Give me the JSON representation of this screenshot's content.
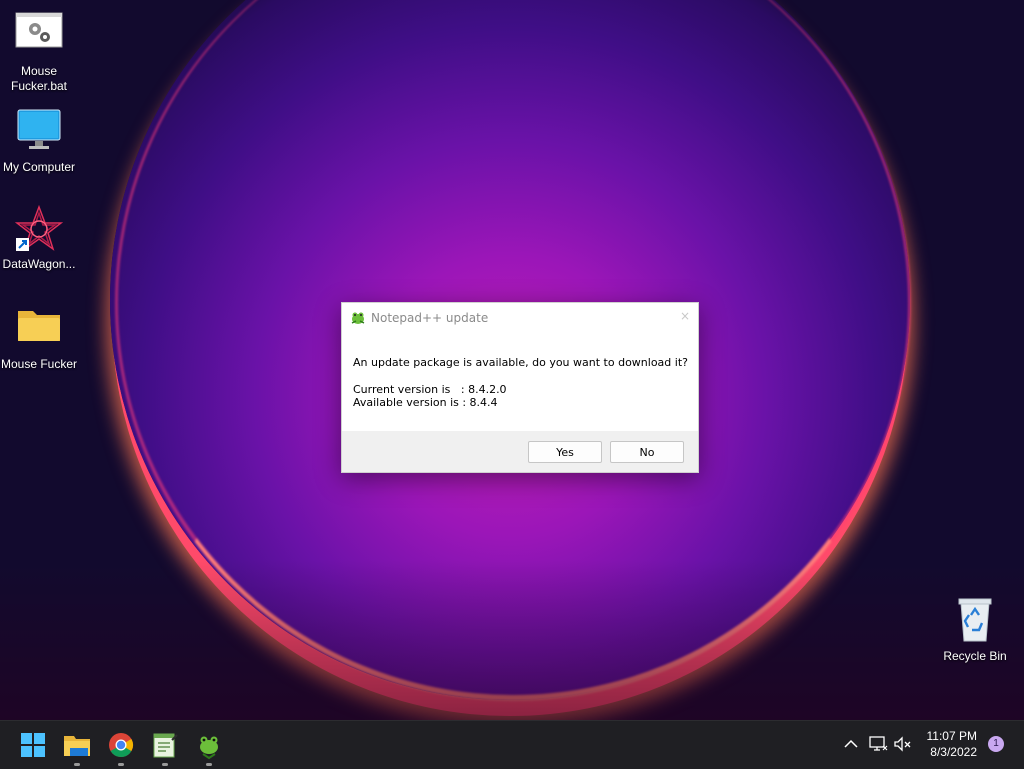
{
  "desktop": {
    "icons": [
      {
        "label": "Mouse\nFucker.bat",
        "icon": "batch-file-gears-icon"
      },
      {
        "label": "My Computer",
        "icon": "monitor-icon"
      },
      {
        "label": "DataWagon...",
        "icon": "datawagon-shortcut-icon"
      },
      {
        "label": "Mouse Fucker",
        "icon": "folder-icon"
      },
      {
        "label": "Recycle Bin",
        "icon": "recycle-bin-icon"
      }
    ]
  },
  "dialog": {
    "title": "Notepad++ update",
    "close_glyph": "×",
    "message": "An update package is available, do you want to download it?",
    "current_version": "Current version is   : 8.4.2.0",
    "available_version": "Available version is : 8.4.4",
    "yes_label": "Yes",
    "no_label": "No"
  },
  "taskbar": {
    "apps": [
      "start-icon",
      "file-explorer-icon",
      "chrome-icon",
      "notepad-icon",
      "notepad-plus-plus-icon"
    ],
    "tray": {
      "time": "11:07 PM",
      "date": "8/3/2022",
      "notification_count": "1"
    }
  },
  "colors": {
    "taskbar_bg": "#1f1f23",
    "accent": "#0078d4",
    "wallpaper_glow": "#c21fb4"
  }
}
